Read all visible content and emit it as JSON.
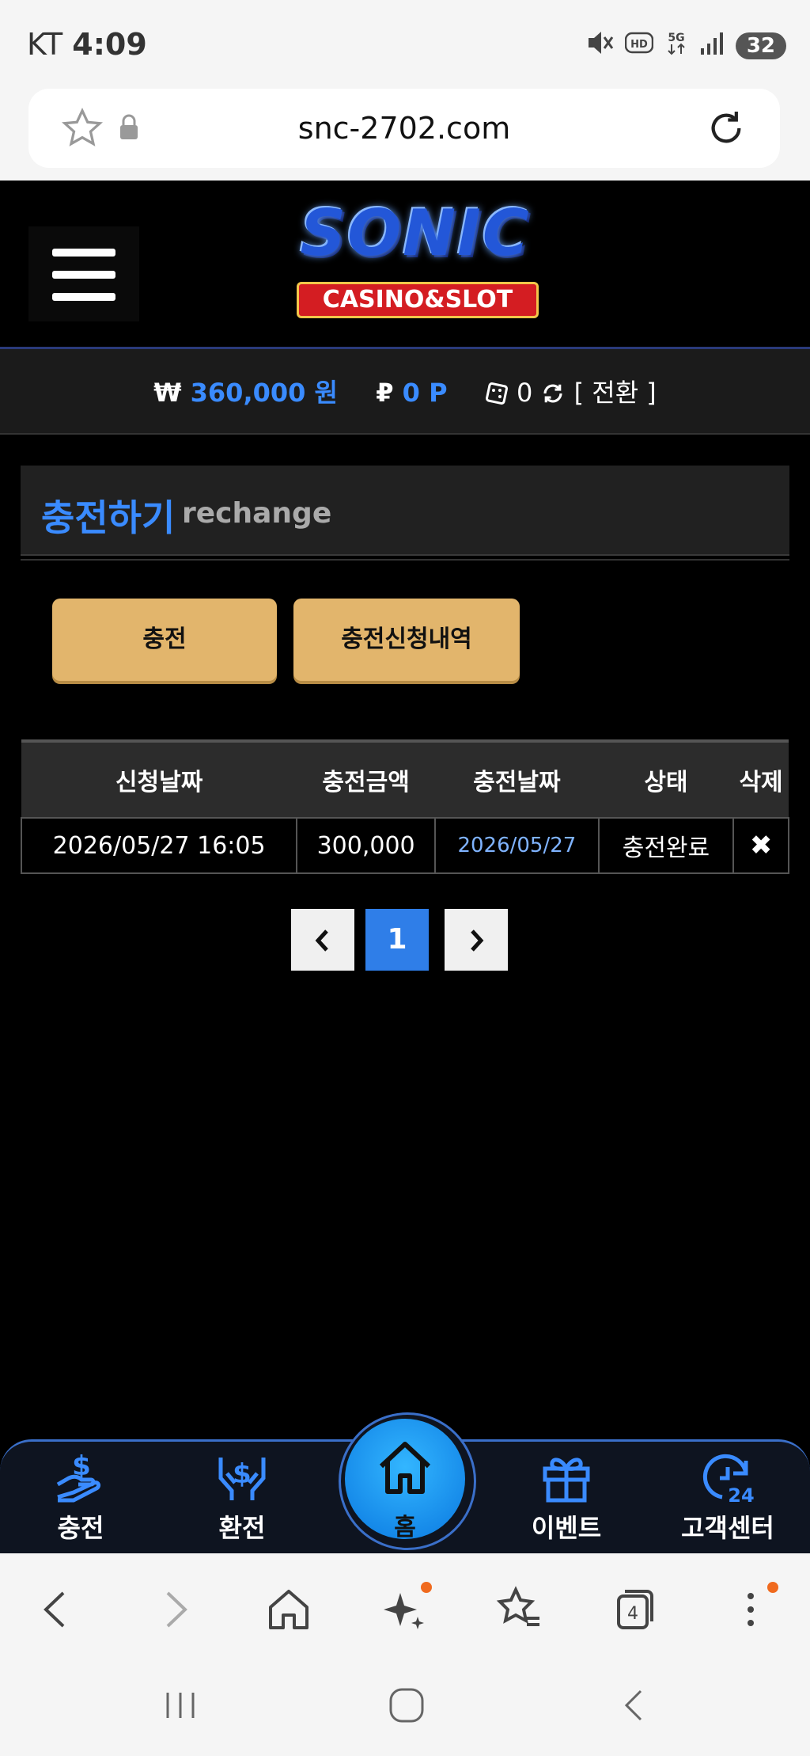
{
  "status_bar": {
    "carrier": "KT",
    "time": "4:09",
    "battery": "32"
  },
  "browser": {
    "url": "snc-2702.com",
    "tab_count": "4"
  },
  "site": {
    "logo_title": "SONIC",
    "logo_subtitle": "CASINO&SLOT"
  },
  "balance": {
    "won_symbol": "₩",
    "won_amount": "360,000 원",
    "point_symbol": "₽",
    "point_amount": "0 P",
    "chip_count": "0",
    "convert_label": "[ 전환 ]"
  },
  "section": {
    "title_ko": "충전하기",
    "title_en": "rechange"
  },
  "buttons": {
    "charge": "충전",
    "history": "충전신청내역"
  },
  "table": {
    "headers": [
      "신청날짜",
      "충전금액",
      "충전날짜",
      "상태",
      "삭제"
    ],
    "rows": [
      {
        "request_date": "2026/05/27 16:05",
        "amount": "300,000",
        "charge_date": "2026/05/27",
        "status": "충전완료",
        "delete": "✖"
      }
    ]
  },
  "pagination": {
    "prev": "‹",
    "current": "1",
    "next": "›"
  },
  "bottom_nav": {
    "charge": "충전",
    "exchange": "환전",
    "home": "홈",
    "event": "이벤트",
    "support": "고객센터"
  },
  "colors": {
    "accent_blue": "#3a8bff",
    "gold_button": "#e2b56c",
    "home_blue": "#1a98f0"
  }
}
